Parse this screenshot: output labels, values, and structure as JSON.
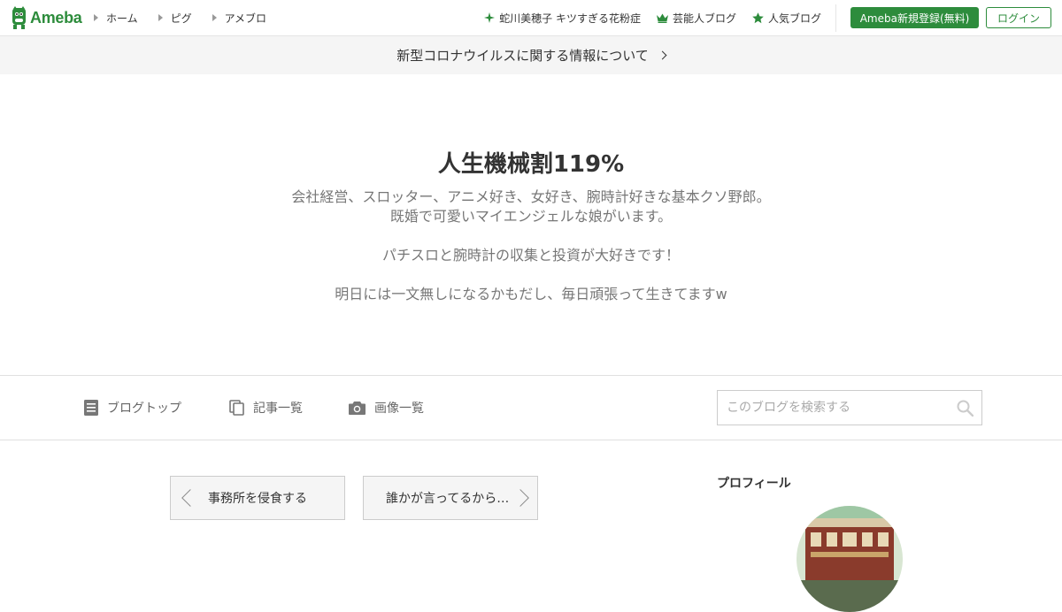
{
  "brand": {
    "name": "Ameba"
  },
  "nav": {
    "left": [
      {
        "label": "ホーム"
      },
      {
        "label": "ピグ"
      },
      {
        "label": "アメブロ"
      }
    ],
    "right": [
      {
        "label": "蛇川美穂子 キツすぎる花粉症",
        "icon": "sparkle-icon"
      },
      {
        "label": "芸能人ブログ",
        "icon": "crown-icon"
      },
      {
        "label": "人気ブログ",
        "icon": "star-icon"
      }
    ],
    "register_label": "Ameba新規登録(無料)",
    "login_label": "ログイン"
  },
  "info_bar": {
    "text": "新型コロナウイルスに関する情報について"
  },
  "blog": {
    "title": "人生機械割119%",
    "description_lines": [
      "会社経営、スロッター、アニメ好き、女好き、腕時計好きな基本クソ野郎。",
      "既婚で可愛いマイエンジェルな娘がいます。",
      "パチスロと腕時計の収集と投資が大好きです！",
      "明日には一文無しになるかもだし、毎日頑張って生きてますw"
    ]
  },
  "tabs": [
    {
      "label": "ブログトップ",
      "icon": "document-icon"
    },
    {
      "label": "記事一覧",
      "icon": "copy-icon"
    },
    {
      "label": "画像一覧",
      "icon": "camera-icon"
    }
  ],
  "search": {
    "placeholder": "このブログを検索する"
  },
  "pager": {
    "prev_label": "事務所を侵食する",
    "next_label": "誰かが言ってるから…"
  },
  "sidebar": {
    "profile_heading": "プロフィール"
  },
  "colors": {
    "brand_green": "#2d8c3c",
    "info_bg": "#f5f5f5"
  }
}
